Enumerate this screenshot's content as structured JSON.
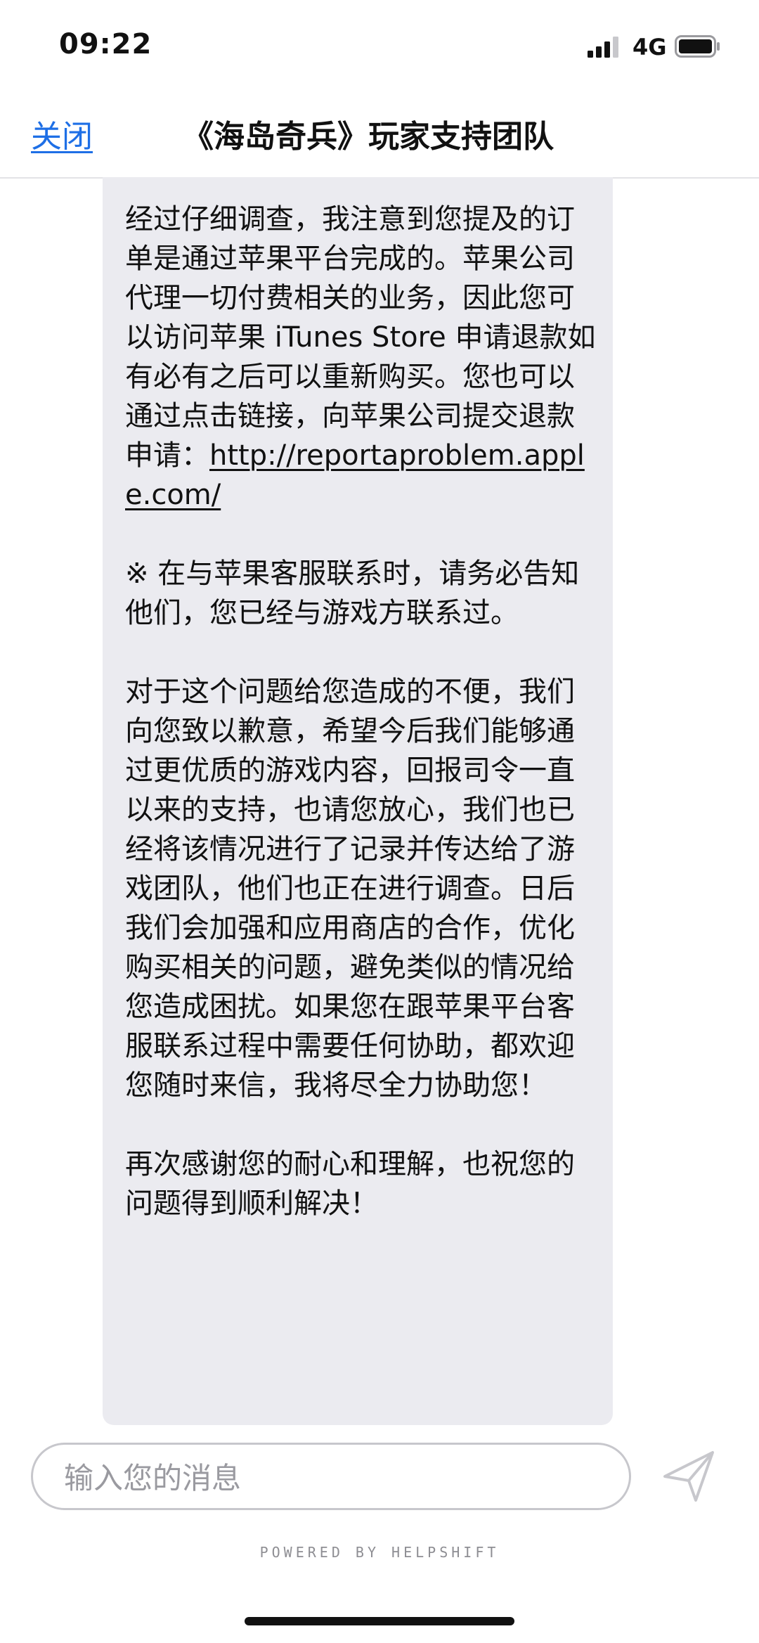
{
  "status_bar": {
    "time": "09:22",
    "network": "4G",
    "icons": [
      "signal-icon",
      "battery-icon"
    ]
  },
  "nav": {
    "close_label": "关闭",
    "title": "《海岛奇兵》玩家支持团队"
  },
  "message": {
    "p1_text": "经过仔细调查，我注意到您提及的订单是通过苹果平台完成的。苹果公司代理一切付费相关的业务，因此您可以访问苹果 iTunes Store 申请退款如有必有之后可以重新购买。您也可以通过点击链接，向苹果公司提交退款申请：",
    "p1_link": "http://reportaproblem.apple.com/",
    "p2": "※ 在与苹果客服联系时，请务必告知他们，您已经与游戏方联系过。",
    "p3": "对于这个问题给您造成的不便，我们向您致以歉意，希望今后我们能够通过更优质的游戏内容，回报司令一直以来的支持，也请您放心，我们也已经将该情况进行了记录并传达给了游戏团队，他们也正在进行调查。日后我们会加强和应用商店的合作，优化购买相关的问题，避免类似的情况给您造成困扰。如果您在跟苹果平台客服联系过程中需要任何协助，都欢迎您随时来信，我将尽全力协助您！",
    "p4": "再次感谢您的耐心和理解，也祝您的问题得到顺利解决！"
  },
  "composer": {
    "placeholder": "输入您的消息",
    "value": ""
  },
  "footer": {
    "powered_by": "POWERED BY HELPSHIFT"
  },
  "colors": {
    "accent": "#1e6fe6",
    "bubble": "#ebebf0",
    "send_icon": "#c7c7cc"
  }
}
